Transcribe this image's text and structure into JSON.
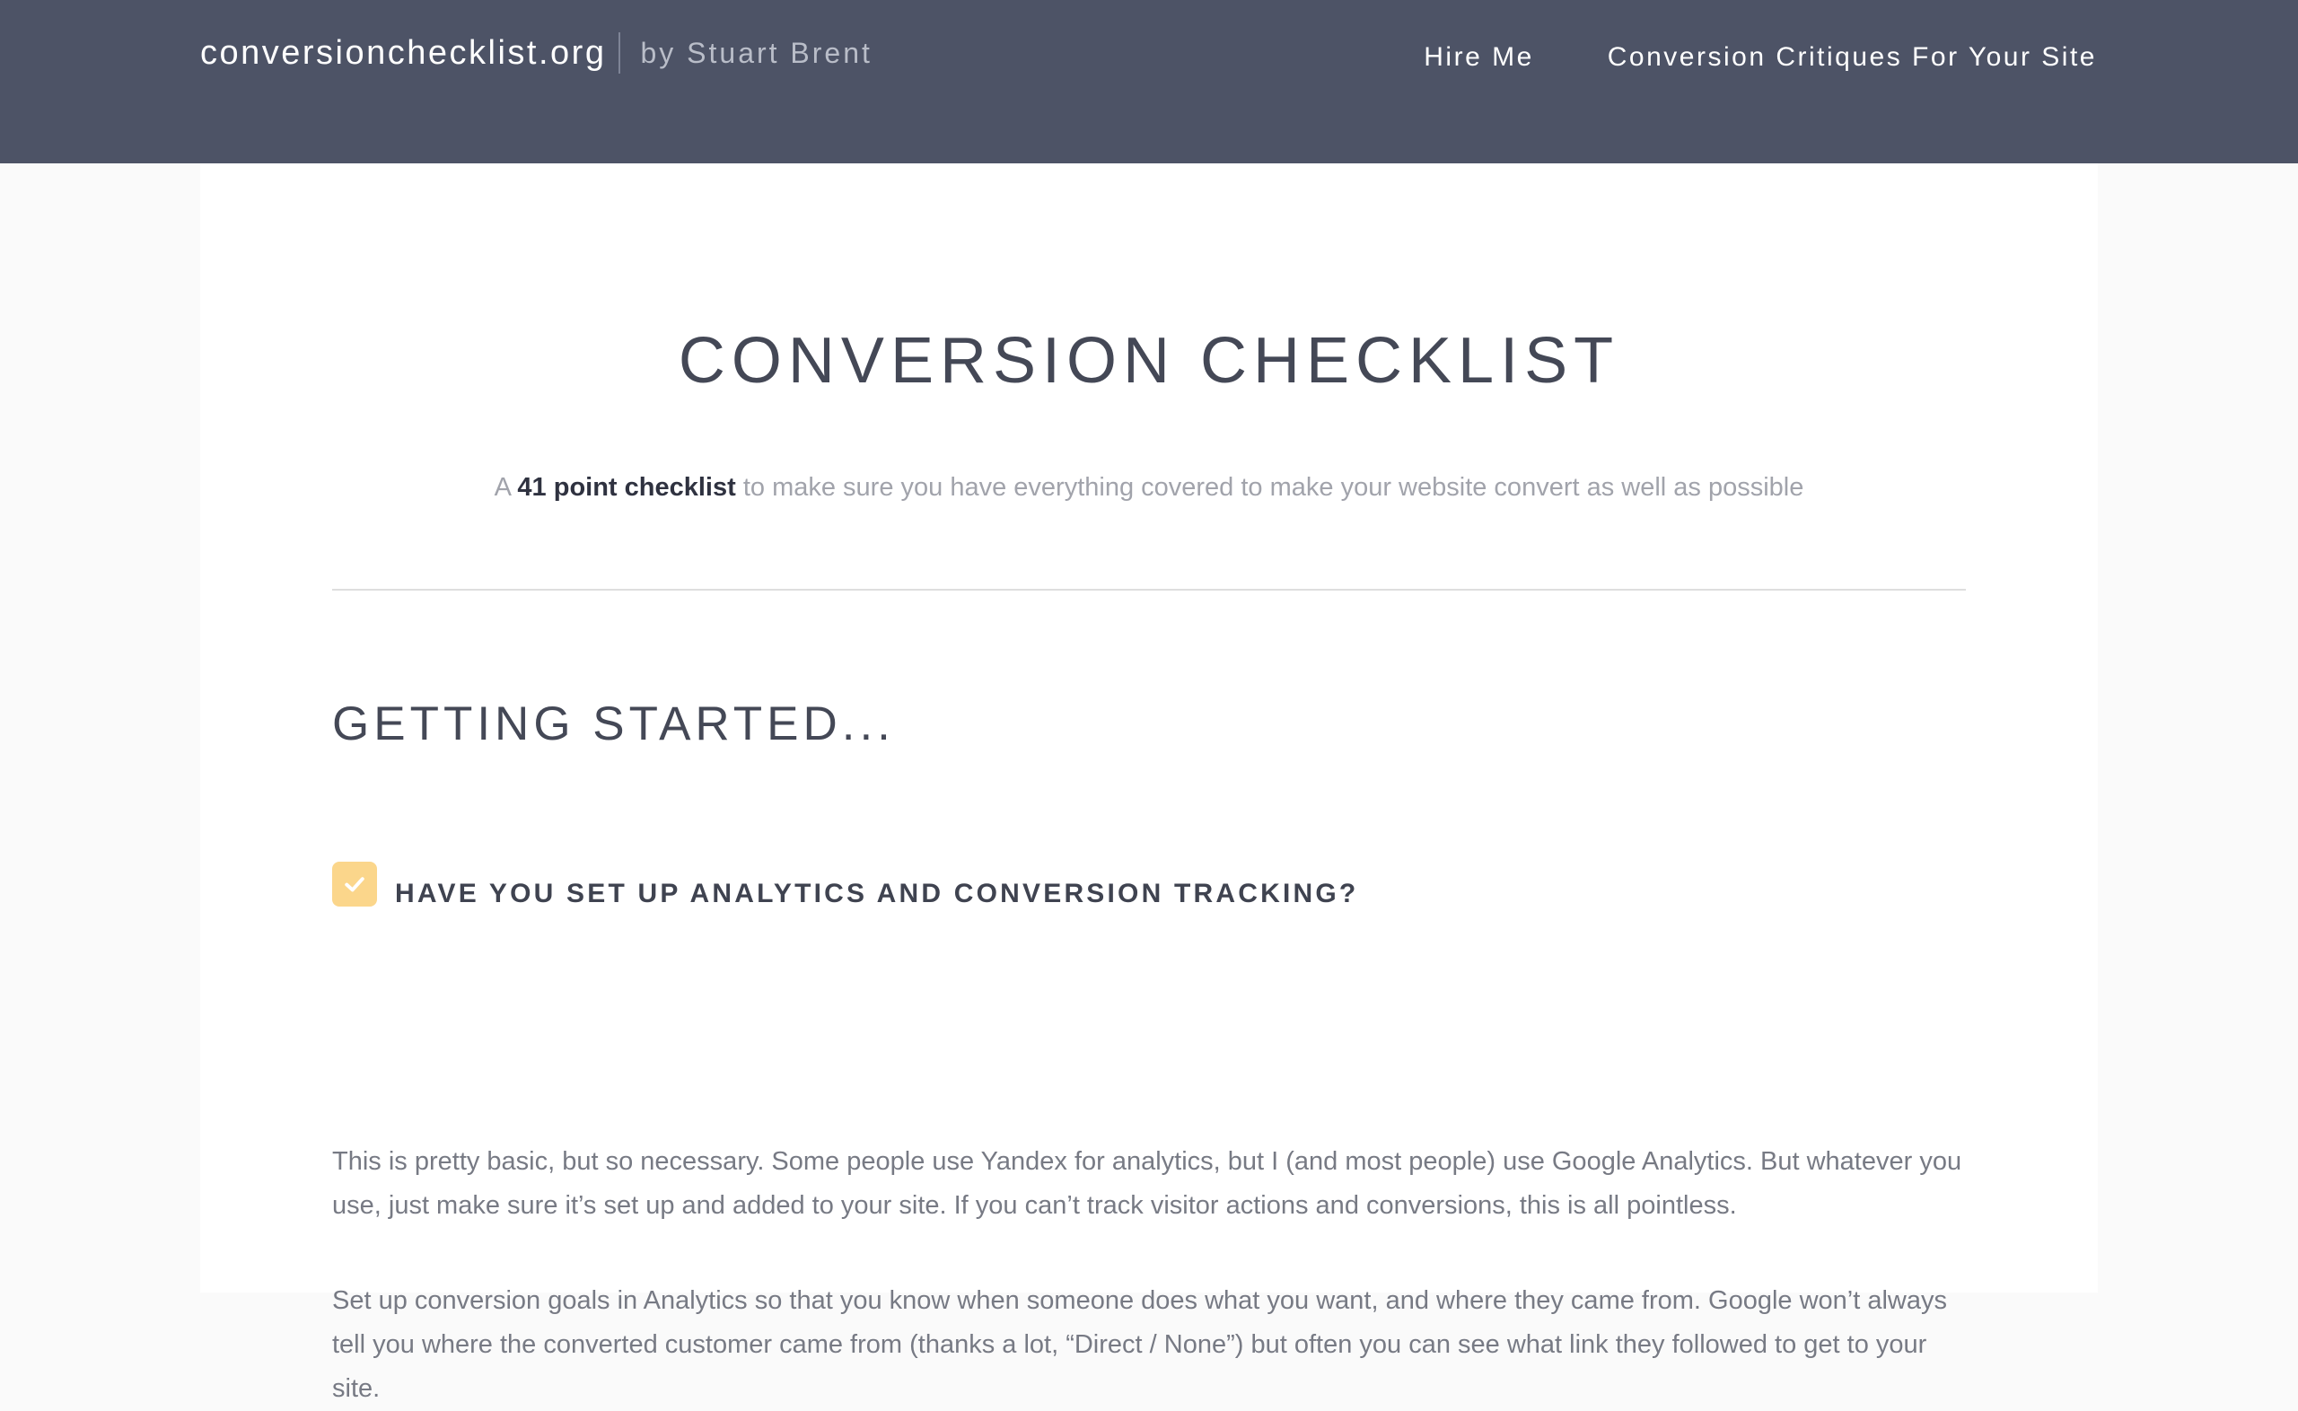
{
  "header": {
    "site_name": "conversionchecklist.org",
    "byline": "by Stuart Brent",
    "nav": [
      {
        "label": "Hire Me"
      },
      {
        "label": "Conversion Critiques For Your Site"
      }
    ]
  },
  "main": {
    "title": "CONVERSION CHECKLIST",
    "subtitle": {
      "prefix": "A ",
      "highlight": "41 point checklist",
      "suffix": " to make sure you have everything covered to make your website convert as well as possible"
    },
    "section": {
      "heading": "GETTING STARTED...",
      "item": {
        "checked": true,
        "check_color": "#fbd68b",
        "heading": "HAVE YOU SET UP ANALYTICS AND CONVERSION TRACKING?",
        "paragraphs": [
          "This is pretty basic, but so necessary. Some people use Yandex for analytics, but I (and most people) use Google Analytics. But whatever you use, just make sure it’s set up and added to your site. If you can’t track visitor actions and conversions, this is all pointless.",
          "Set up conversion goals in Analytics so that you know when someone does what you want, and where they came from. Google won’t always tell you where the converted customer came from (thanks a lot, “Direct / None”) but often you can see what link they followed to get to your site."
        ]
      }
    }
  },
  "colors": {
    "header_bg": "#4d5366",
    "accent": "#fbd68b",
    "text_dark": "#444856",
    "text_muted": "#777a84"
  }
}
